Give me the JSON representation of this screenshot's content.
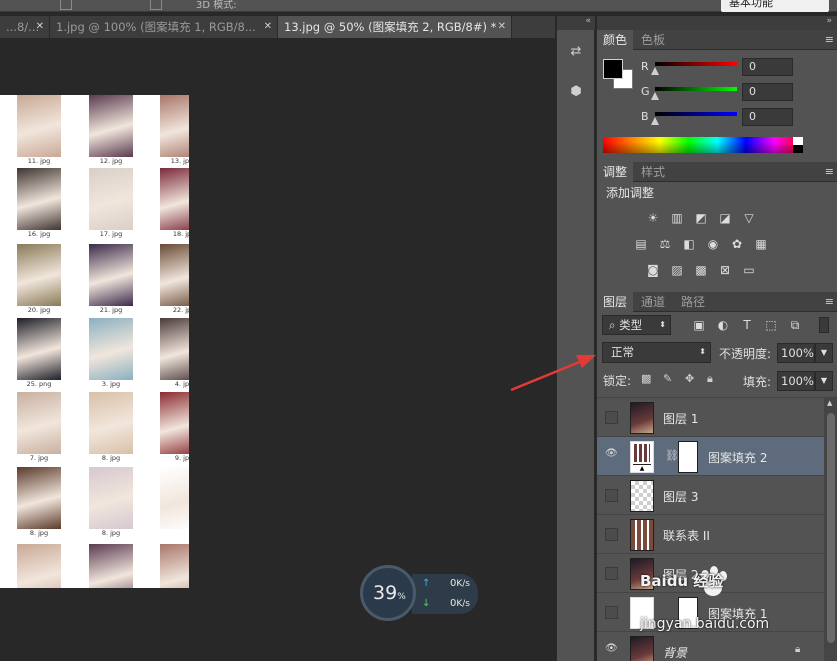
{
  "options_bar": {
    "mode_text": "3D 模式:",
    "workspace": "基本功能"
  },
  "doc_tabs": [
    {
      "label": "...8/...",
      "active": false
    },
    {
      "label": "1.jpg @ 100% (图案填充 1, RGB/8...",
      "active": false
    },
    {
      "label": "13.jpg @ 50% (图案填充 2, RGB/8#) *",
      "active": true
    }
  ],
  "document": {
    "thumbnails": [
      {
        "caption": "11. jpg",
        "color": "#c9a896"
      },
      {
        "caption": "12. jpg",
        "color": "#5a3a50"
      },
      {
        "caption": "13. jpg",
        "color": "#a8766a"
      },
      {
        "caption": "16. jpg",
        "color": "#3e3430"
      },
      {
        "caption": "17. jpg",
        "color": "#d8cfc6"
      },
      {
        "caption": "18. jp",
        "color": "#7a2a3a"
      },
      {
        "caption": "20. jpg",
        "color": "#8a7a58"
      },
      {
        "caption": "21. jpg",
        "color": "#3a2a4a"
      },
      {
        "caption": "22. jp",
        "color": "#6a4a36"
      },
      {
        "caption": "25. png",
        "color": "#1e1e28"
      },
      {
        "caption": "3. jpg",
        "color": "#8ab0c0"
      },
      {
        "caption": "4. jp",
        "color": "#4a3a3a"
      },
      {
        "caption": "7. jpg",
        "color": "#c8b0a0"
      },
      {
        "caption": "8. jpg",
        "color": "#d8c0a8"
      },
      {
        "caption": "9. jp",
        "color": "#8a2a30"
      },
      {
        "caption": "8. jpg",
        "color": "#5a3a2a"
      },
      {
        "caption": "8. jpg",
        "color": "#d6c8d0"
      },
      {
        "caption": "",
        "color": "#ffffff"
      },
      {
        "caption": "",
        "color": "#c9a896"
      },
      {
        "caption": "",
        "color": "#5a3a50"
      },
      {
        "caption": "",
        "color": "#a8766a"
      }
    ]
  },
  "net_meter": {
    "percent": "39",
    "percent_sign": "%",
    "upload": "0",
    "upload_unit": "K/s",
    "download": "0",
    "download_unit": "K/s"
  },
  "color_panel": {
    "tabs": [
      "颜色",
      "色板"
    ],
    "channels": [
      {
        "label": "R",
        "value": "0"
      },
      {
        "label": "G",
        "value": "0"
      },
      {
        "label": "B",
        "value": "0"
      }
    ]
  },
  "adjust_panel": {
    "tabs": [
      "调整",
      "样式"
    ],
    "title": "添加调整"
  },
  "layers_panel": {
    "tabs": [
      "图层",
      "通道",
      "路径"
    ],
    "filter_kind": "类型",
    "blend_mode": "正常",
    "opacity_label": "不透明度:",
    "opacity_value": "100%",
    "lock_label": "锁定:",
    "fill_label": "填充:",
    "fill_value": "100%",
    "layers": [
      {
        "name": "图层 1",
        "visible": false,
        "selected": false
      },
      {
        "name": "图案填充 2",
        "visible": true,
        "selected": true
      },
      {
        "name": "图层 3",
        "visible": false,
        "selected": false
      },
      {
        "name": "联系表 II",
        "visible": false,
        "selected": false
      },
      {
        "name": "图层 2",
        "visible": false,
        "selected": false
      },
      {
        "name": "图案填充 1",
        "visible": false,
        "selected": false
      },
      {
        "name": "背景",
        "visible": true,
        "selected": false
      }
    ]
  },
  "watermark": {
    "brand": "Baidu 经验",
    "url": "jingyan.baidu.com"
  },
  "colors": {
    "annotation_arrow": "#e53935",
    "selected_row": "#5e6b7c"
  }
}
